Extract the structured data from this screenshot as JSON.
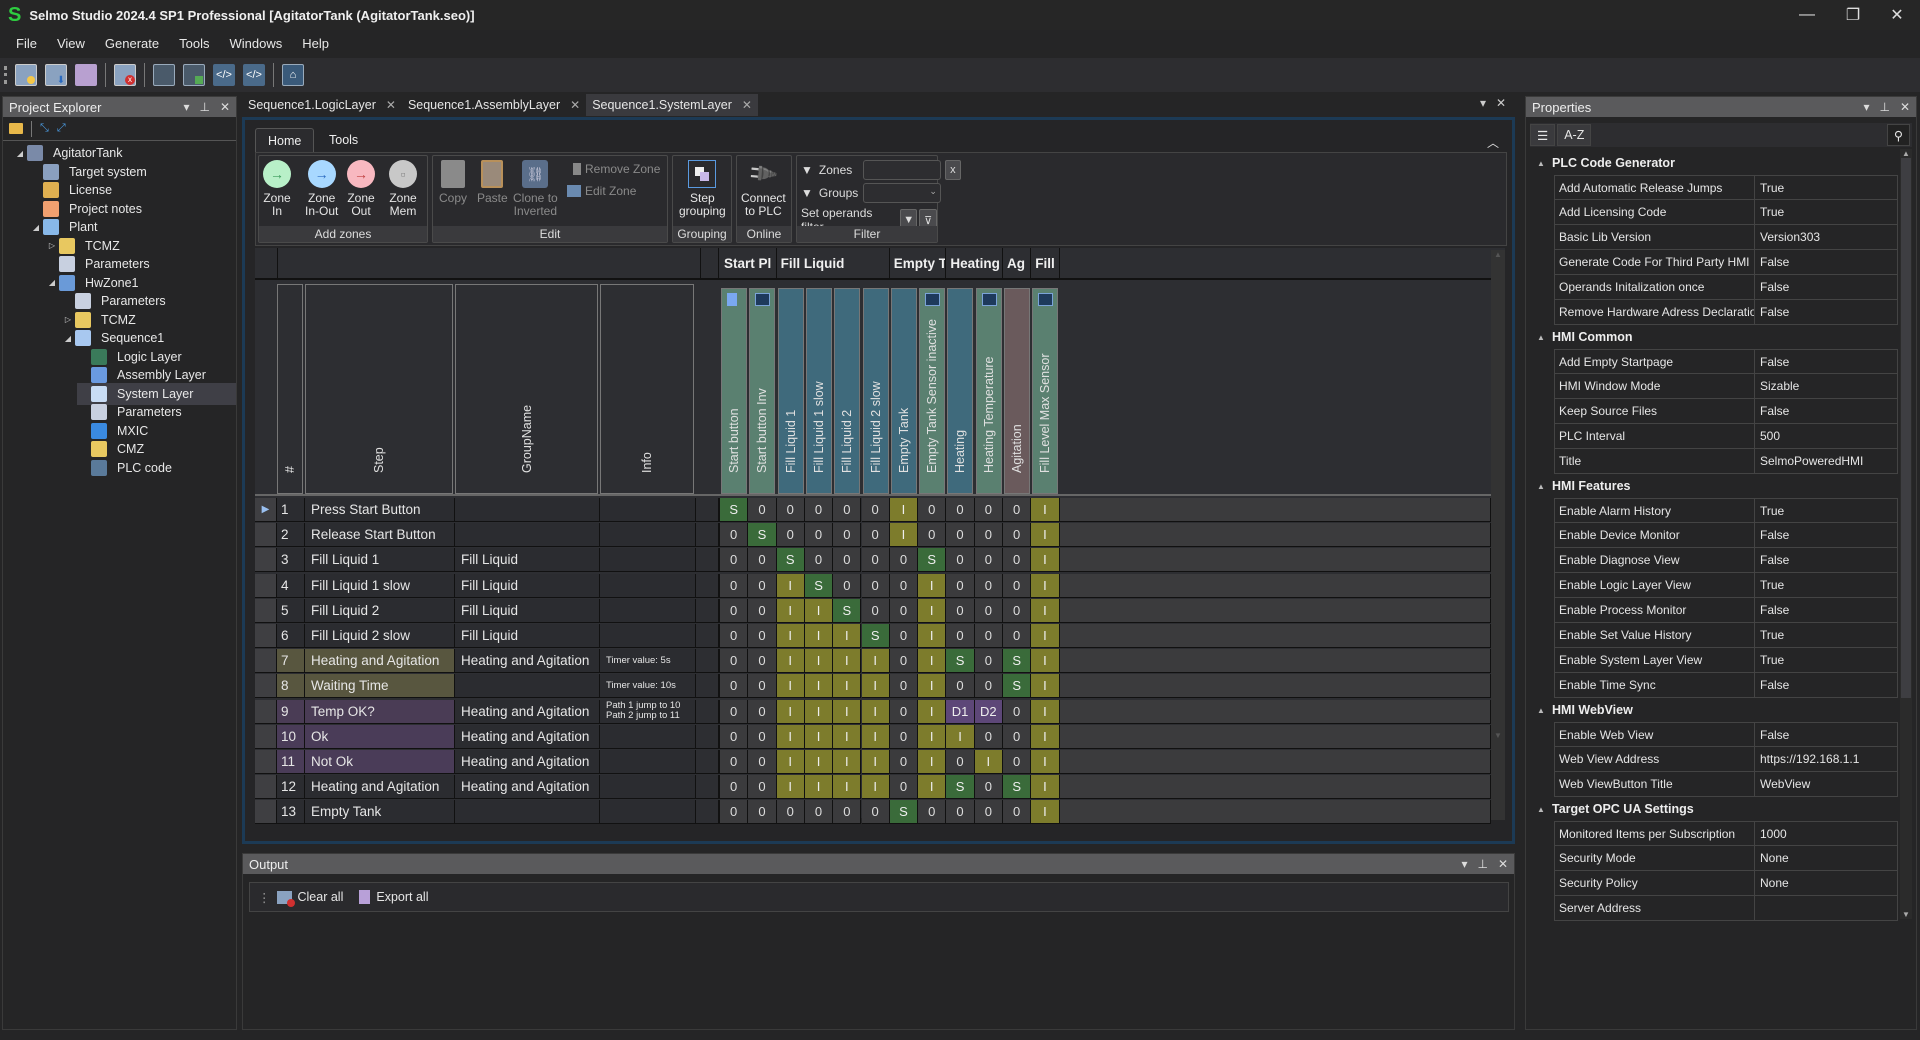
{
  "window": {
    "title": "Selmo Studio 2024.4 SP1 Professional  [AgitatorTank (AgitatorTank.seo)]",
    "logo": "S",
    "controls": {
      "minimize": "—",
      "restore": "❐",
      "close": "✕"
    }
  },
  "menu": [
    "File",
    "View",
    "Generate",
    "Tools",
    "Windows",
    "Help"
  ],
  "toolbar": {
    "icons": [
      "new-project-icon",
      "open-project-icon",
      "save-icon",
      "close-project-icon",
      "layout-icon",
      "run-layout-icon",
      "code-icon",
      "code-remove-icon",
      "home-icon"
    ]
  },
  "explorer": {
    "title": "Project Explorer",
    "tree": [
      {
        "label": "AgitatorTank",
        "level": 0,
        "expander": "expanded",
        "icon": "project-icon"
      },
      {
        "label": "Target system",
        "level": 1,
        "expander": "none",
        "icon": "monitor-icon"
      },
      {
        "label": "License",
        "level": 1,
        "expander": "none",
        "icon": "key-icon"
      },
      {
        "label": "Project notes",
        "level": 1,
        "expander": "none",
        "icon": "notes-icon"
      },
      {
        "label": "Plant",
        "level": 1,
        "expander": "expanded",
        "icon": "plant-icon"
      },
      {
        "label": "TCMZ",
        "level": 2,
        "expander": "collapsed",
        "icon": "folder-icon"
      },
      {
        "label": "Parameters",
        "level": 2,
        "expander": "none",
        "icon": "parameters-icon"
      },
      {
        "label": "HwZone1",
        "level": 2,
        "expander": "expanded",
        "icon": "hwzone-icon"
      },
      {
        "label": "Parameters",
        "level": 3,
        "expander": "none",
        "icon": "parameters-icon"
      },
      {
        "label": "TCMZ",
        "level": 3,
        "expander": "collapsed",
        "icon": "folder-icon"
      },
      {
        "label": "Sequence1",
        "level": 3,
        "expander": "expanded",
        "icon": "sequence-icon"
      },
      {
        "label": "Logic Layer",
        "level": 4,
        "expander": "none",
        "icon": "logic-layer-icon"
      },
      {
        "label": "Assembly Layer",
        "level": 4,
        "expander": "none",
        "icon": "assembly-layer-icon"
      },
      {
        "label": "System Layer",
        "level": 4,
        "expander": "none",
        "icon": "system-layer-icon",
        "selected": true
      },
      {
        "label": "Parameters",
        "level": 4,
        "expander": "none",
        "icon": "parameters-icon"
      },
      {
        "label": "MXIC",
        "level": 4,
        "expander": "none",
        "icon": "mxic-icon"
      },
      {
        "label": "CMZ",
        "level": 4,
        "expander": "none",
        "icon": "folder-icon"
      },
      {
        "label": "PLC code",
        "level": 4,
        "expander": "none",
        "icon": "plc-code-icon"
      }
    ]
  },
  "doc_tabs": [
    {
      "label": "Sequence1.LogicLayer",
      "active": false
    },
    {
      "label": "Sequence1.AssemblyLayer",
      "active": false
    },
    {
      "label": "Sequence1.SystemLayer",
      "active": true
    }
  ],
  "ribbon": {
    "tabs": [
      "Home",
      "Tools"
    ],
    "active_tab": "Home",
    "groups": {
      "add_zones": {
        "label": "Add zones",
        "buttons": [
          {
            "label1": "Zone",
            "label2": "In",
            "color": "#b8f0c8",
            "arrow": "#3a9a5a"
          },
          {
            "label1": "Zone",
            "label2": "In-Out",
            "color": "#a8d8ff",
            "arrow": "#2a6ac0"
          },
          {
            "label1": "Zone",
            "label2": "Out",
            "color": "#f8b8c0",
            "arrow": "#c04040"
          },
          {
            "label1": "Zone",
            "label2": "Mem",
            "color": "#c8c8c8",
            "arrow": "#888"
          }
        ]
      },
      "edit": {
        "label": "Edit",
        "copy": "Copy",
        "paste": "Paste",
        "clone1": "Clone to",
        "clone2": "Inverted",
        "remove_zone": "Remove Zone",
        "edit_zone": "Edit Zone"
      },
      "grouping": {
        "label": "Grouping",
        "btn1": "Step",
        "btn2": "grouping"
      },
      "online": {
        "label": "Online",
        "btn1": "Connect",
        "btn2": "to PLC"
      },
      "filter": {
        "label": "Filter",
        "zones_label": "Zones",
        "zones_value": "",
        "clear": "x",
        "groups_label": "Groups",
        "groups_value": "",
        "set_operands": "Set operands filter"
      }
    }
  },
  "grid": {
    "left_headers": [
      "#",
      "Step",
      "GroupName",
      "Info"
    ],
    "zone_groups": [
      {
        "label": "Start Pl",
        "span": 2
      },
      {
        "label": "Fill Liquid",
        "span": 4
      },
      {
        "label": "Empty T",
        "span": 2
      },
      {
        "label": "Heating",
        "span": 2
      },
      {
        "label": "Ag",
        "span": 1
      },
      {
        "label": "Fill",
        "span": 1
      }
    ],
    "operands": [
      {
        "label": "Start button",
        "color": "#5a8070",
        "icon": "input-icon"
      },
      {
        "label": "Start button Inv",
        "color": "#5a8070",
        "icon": "sensor-icon"
      },
      {
        "label": "Fill Liquid 1",
        "color": "#3f6a7c",
        "icon": ""
      },
      {
        "label": "Fill Liquid 1 slow",
        "color": "#3f6a7c",
        "icon": ""
      },
      {
        "label": "Fill Liquid 2",
        "color": "#3f6a7c",
        "icon": ""
      },
      {
        "label": "Fill Liquid 2 slow",
        "color": "#3f6a7c",
        "icon": ""
      },
      {
        "label": "Empty Tank",
        "color": "#3f6a7c",
        "icon": ""
      },
      {
        "label": "Empty Tank Sensor inactive",
        "color": "#5a8070",
        "icon": "sensor-icon"
      },
      {
        "label": "Heating",
        "color": "#3f6a7c",
        "icon": ""
      },
      {
        "label": "Heating Temperature",
        "color": "#5a8070",
        "icon": "sensor-icon"
      },
      {
        "label": "Agitation",
        "color": "#6a5a5c",
        "icon": ""
      },
      {
        "label": "Fill Level Max Sensor",
        "color": "#5a8070",
        "icon": "sensor-icon"
      }
    ],
    "rows": [
      {
        "num": "1",
        "step": "Press Start Button",
        "group": "",
        "info": [],
        "style": "normal",
        "current": true,
        "ops": [
          "S",
          "0",
          "0",
          "0",
          "0",
          "0",
          "I",
          "0",
          "0",
          "0",
          "0",
          "I"
        ]
      },
      {
        "num": "2",
        "step": "Release Start Button",
        "group": "",
        "info": [],
        "style": "normal",
        "ops": [
          "0",
          "S",
          "0",
          "0",
          "0",
          "0",
          "I",
          "0",
          "0",
          "0",
          "0",
          "I"
        ]
      },
      {
        "num": "3",
        "step": "Fill Liquid 1",
        "group": "Fill Liquid",
        "info": [],
        "style": "normal",
        "ops": [
          "0",
          "0",
          "S",
          "0",
          "0",
          "0",
          "0",
          "S",
          "0",
          "0",
          "0",
          "I"
        ]
      },
      {
        "num": "4",
        "step": "Fill Liquid 1 slow",
        "group": "Fill Liquid",
        "info": [],
        "style": "normal",
        "ops": [
          "0",
          "0",
          "I",
          "S",
          "0",
          "0",
          "0",
          "I",
          "0",
          "0",
          "0",
          "I"
        ]
      },
      {
        "num": "5",
        "step": "Fill Liquid 2",
        "group": "Fill Liquid",
        "info": [],
        "style": "normal",
        "ops": [
          "0",
          "0",
          "I",
          "I",
          "S",
          "0",
          "0",
          "I",
          "0",
          "0",
          "0",
          "I"
        ]
      },
      {
        "num": "6",
        "step": "Fill Liquid 2 slow",
        "group": "Fill Liquid",
        "info": [],
        "style": "normal",
        "ops": [
          "0",
          "0",
          "I",
          "I",
          "I",
          "S",
          "0",
          "I",
          "0",
          "0",
          "0",
          "I"
        ]
      },
      {
        "num": "7",
        "step": "Heating and Agitation",
        "group": "Heating and Agitation",
        "info": [
          "Timer value: 5s"
        ],
        "style": "timer",
        "ops": [
          "0",
          "0",
          "I",
          "I",
          "I",
          "I",
          "0",
          "I",
          "S",
          "0",
          "S",
          "I"
        ]
      },
      {
        "num": "8",
        "step": "Waiting Time",
        "group": "",
        "info": [
          "Timer value: 10s"
        ],
        "style": "timer",
        "ops": [
          "0",
          "0",
          "I",
          "I",
          "I",
          "I",
          "0",
          "I",
          "0",
          "0",
          "S",
          "I"
        ]
      },
      {
        "num": "9",
        "step": "Temp OK?",
        "group": "Heating and Agitation",
        "info": [
          "Path 1 jump to 10",
          "Path 2 jump to 11"
        ],
        "style": "decision",
        "ops": [
          "0",
          "0",
          "I",
          "I",
          "I",
          "I",
          "0",
          "I",
          "D1",
          "D2",
          "0",
          "I"
        ]
      },
      {
        "num": "10",
        "step": "Ok",
        "group": "Heating and Agitation",
        "info": [],
        "style": "branch",
        "ops": [
          "0",
          "0",
          "I",
          "I",
          "I",
          "I",
          "0",
          "I",
          "I",
          "0",
          "0",
          "I"
        ]
      },
      {
        "num": "11",
        "step": "Not Ok",
        "group": "Heating and Agitation",
        "info": [],
        "style": "branch",
        "ops": [
          "0",
          "0",
          "I",
          "I",
          "I",
          "I",
          "0",
          "I",
          "0",
          "I",
          "0",
          "I"
        ]
      },
      {
        "num": "12",
        "step": "Heating and Agitation",
        "group": "Heating and Agitation",
        "info": [],
        "style": "normal",
        "ops": [
          "0",
          "0",
          "I",
          "I",
          "I",
          "I",
          "0",
          "I",
          "S",
          "0",
          "S",
          "I"
        ]
      },
      {
        "num": "13",
        "step": "Empty Tank",
        "group": "",
        "info": [],
        "style": "normal",
        "ops": [
          "0",
          "0",
          "0",
          "0",
          "0",
          "0",
          "S",
          "0",
          "0",
          "0",
          "0",
          "I"
        ]
      }
    ]
  },
  "output": {
    "title": "Output",
    "clear_all": "Clear all",
    "export_all": "Export all"
  },
  "properties": {
    "title": "Properties",
    "az_label": "A-Z",
    "categories": [
      {
        "name": "PLC Code Generator",
        "items": [
          {
            "name": "Add Automatic Release Jumps",
            "value": "True"
          },
          {
            "name": "Add Licensing Code",
            "value": "True"
          },
          {
            "name": "Basic Lib Version",
            "value": "Version303"
          },
          {
            "name": "Generate Code For Third Party HMI",
            "value": "False"
          },
          {
            "name": "Operands Initalization once",
            "value": "False"
          },
          {
            "name": "Remove Hardware Adress Declaration",
            "value": "False"
          }
        ]
      },
      {
        "name": "HMI Common",
        "items": [
          {
            "name": "Add Empty Startpage",
            "value": "False"
          },
          {
            "name": "HMI Window Mode",
            "value": "Sizable"
          },
          {
            "name": "Keep Source Files",
            "value": "False"
          },
          {
            "name": "PLC Interval",
            "value": "500"
          },
          {
            "name": "Title",
            "value": "SelmoPoweredHMI"
          }
        ]
      },
      {
        "name": "HMI Features",
        "items": [
          {
            "name": "Enable Alarm History",
            "value": "True"
          },
          {
            "name": "Enable Device Monitor",
            "value": "False"
          },
          {
            "name": "Enable Diagnose View",
            "value": "False"
          },
          {
            "name": "Enable Logic Layer View",
            "value": "True"
          },
          {
            "name": "Enable Process Monitor",
            "value": "False"
          },
          {
            "name": "Enable Set Value History",
            "value": "True"
          },
          {
            "name": "Enable System Layer View",
            "value": "True"
          },
          {
            "name": "Enable Time Sync",
            "value": "False"
          }
        ]
      },
      {
        "name": "HMI WebView",
        "items": [
          {
            "name": "Enable Web View",
            "value": "False"
          },
          {
            "name": "Web View Address",
            "value": "https://192.168.1.1"
          },
          {
            "name": "Web ViewButton Title",
            "value": "WebView"
          }
        ]
      },
      {
        "name": "Target OPC UA Settings",
        "items": [
          {
            "name": "Monitored Items per Subscription",
            "value": "1000"
          },
          {
            "name": "Security Mode",
            "value": "None"
          },
          {
            "name": "Security Policy",
            "value": "None"
          },
          {
            "name": "Server Address",
            "value": ""
          }
        ]
      }
    ]
  },
  "colors": {
    "accent_border": "#1c3a55",
    "op_set": "#3a6b3a",
    "op_inactive": "#7d7c2c",
    "op_decision": "#5d4778",
    "op_zero": "#3b3b3d"
  }
}
